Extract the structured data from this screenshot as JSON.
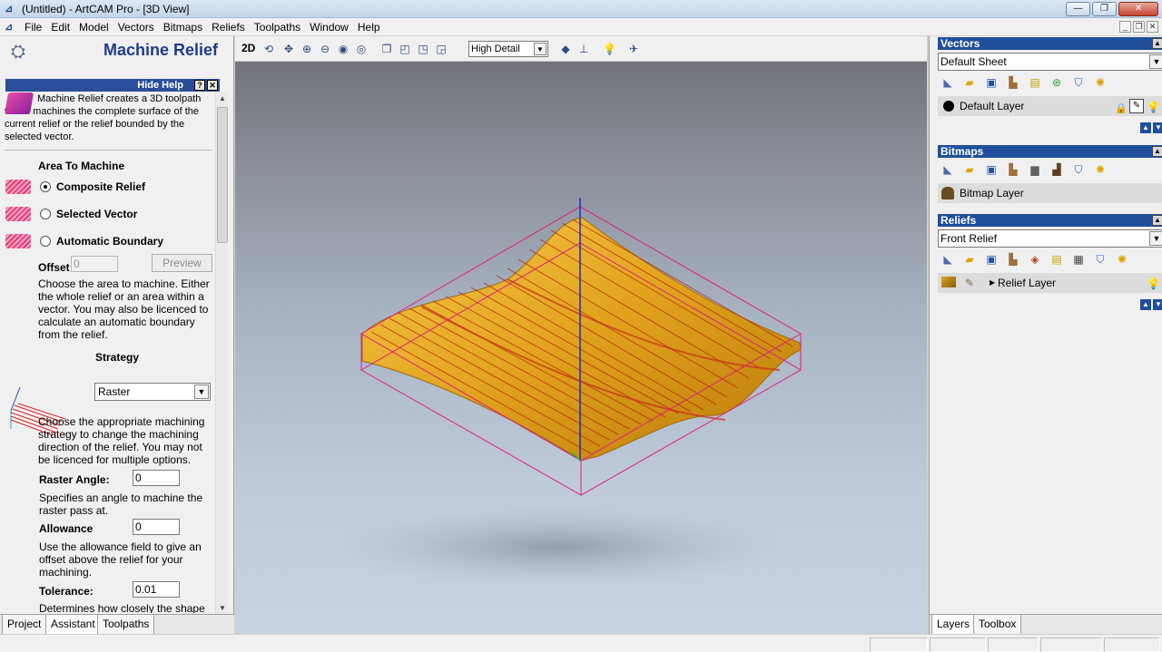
{
  "window": {
    "title": "(Untitled) - ArtCAM Pro - [3D View]",
    "min": "—",
    "restore": "❐",
    "close": "✕"
  },
  "menu": {
    "items": [
      "File",
      "Edit",
      "Model",
      "Vectors",
      "Bitmaps",
      "Reliefs",
      "Toolpaths",
      "Window",
      "Help"
    ],
    "mdi_min": "_",
    "mdi_restore": "❐",
    "mdi_close": "✕"
  },
  "left": {
    "title": "Machine Relief",
    "hide_help": "Hide Help",
    "help_q": "?",
    "help_x": "✕",
    "help_text": "Machine Relief creates a 3D toolpath which machines the complete surface of the current relief or the relief bounded by the selected vector.",
    "area_title": "Area To Machine",
    "radio_composite": "Composite Relief",
    "radio_selected": "Selected Vector",
    "radio_automatic": "Automatic Boundary",
    "offset_label": "Offset",
    "offset_value": "0",
    "preview_label": "Preview",
    "area_help": "Choose the area to machine. Either the whole relief or an area within a vector. You may also be licenced to calculate an automatic boundary from the relief.",
    "strategy_title": "Strategy",
    "strategy_value": "Raster",
    "strategy_help": "Choose the appropriate machining strategy to change the machining direction of the relief. You may not be licenced for multiple options.",
    "raster_angle_label": "Raster Angle:",
    "raster_angle_value": "0",
    "raster_angle_help": "Specifies an angle to machine the raster pass at.",
    "allowance_label": "Allowance",
    "allowance_value": "0",
    "allowance_help": "Use the allowance field to give an offset above the relief for your machining.",
    "tolerance_label": "Tolerance:",
    "tolerance_value": "0.01",
    "tolerance_help": "Determines how closely the shape",
    "tabs": [
      "Project",
      "Assistant",
      "Toolpaths"
    ]
  },
  "toolbar": {
    "mode_2d": "2D",
    "detail": "High Detail"
  },
  "right": {
    "vectors_title": "Vectors",
    "vectors_sheet": "Default Sheet",
    "vectors_layer": "Default Layer",
    "bitmaps_title": "Bitmaps",
    "bitmaps_layer": "Bitmap Layer",
    "reliefs_title": "Reliefs",
    "reliefs_select": "Front Relief",
    "reliefs_layer": "Relief Layer",
    "tabs": [
      "Layers",
      "Toolbox"
    ]
  },
  "colors": {
    "accent": "#1f4f9a",
    "relief": "#e6ac1e",
    "bbox": "#e0207f"
  }
}
